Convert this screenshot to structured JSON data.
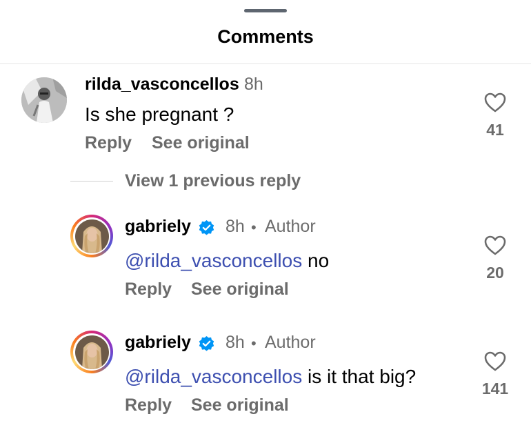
{
  "header": {
    "title": "Comments"
  },
  "comments": [
    {
      "username": "rilda_vasconcellos",
      "time": "8h",
      "text": "Is she pregnant ?",
      "reply_label": "Reply",
      "see_original_label": "See original",
      "likes": "41"
    }
  ],
  "view_replies": {
    "label": "View 1 previous reply"
  },
  "replies": [
    {
      "username": "gabriely",
      "time": "8h",
      "separator": "•",
      "author_label": "Author",
      "mention": "@rilda_vasconcellos",
      "text": " no",
      "reply_label": "Reply",
      "see_original_label": "See original",
      "likes": "20"
    },
    {
      "username": "gabriely",
      "time": "8h",
      "separator": "•",
      "author_label": "Author",
      "mention": "@rilda_vasconcellos",
      "text": " is it that big?",
      "reply_label": "Reply",
      "see_original_label": "See original",
      "likes": "141"
    }
  ],
  "colors": {
    "mention": "#3d4fb0",
    "secondary_text": "#6b6b6b",
    "verified_badge": "#0095f6"
  }
}
